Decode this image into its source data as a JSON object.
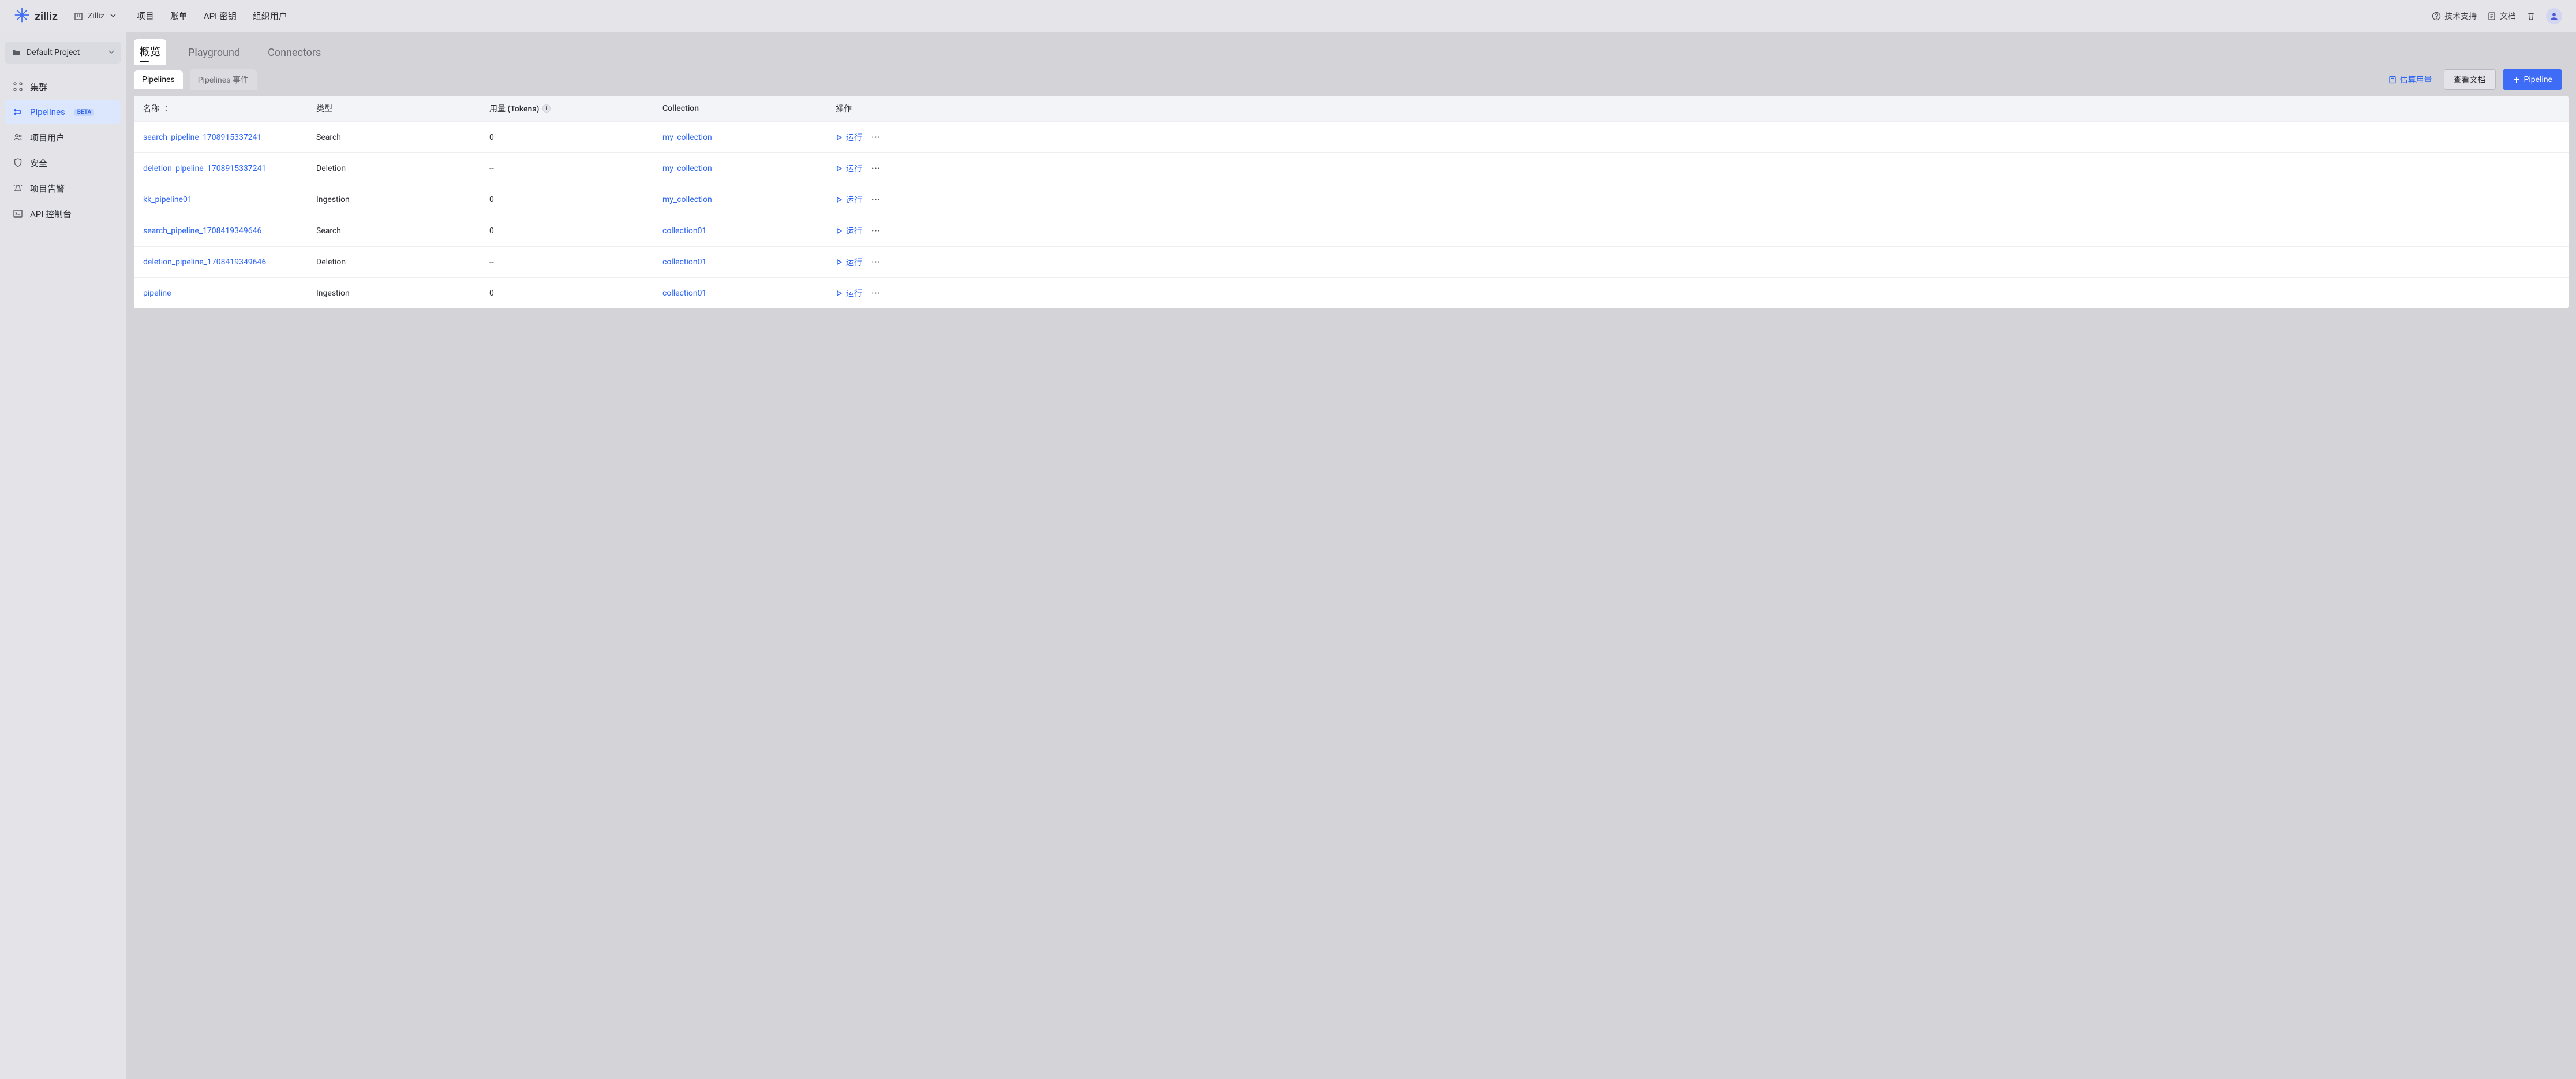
{
  "header": {
    "logo_text": "zilliz",
    "org": {
      "name": "Zilliz"
    },
    "nav": {
      "projects": "项目",
      "billing": "账单",
      "api_keys": "API 密钥",
      "org_users": "组织用户"
    },
    "right": {
      "support": "技术支持",
      "docs": "文档"
    }
  },
  "sidebar": {
    "project": "Default Project",
    "items": {
      "clusters": "集群",
      "pipelines": "Pipelines",
      "pipelines_beta": "BETA",
      "project_users": "项目用户",
      "security": "安全",
      "alerts": "项目告警",
      "api_console": "API 控制台"
    }
  },
  "tabs_top": {
    "overview": "概览",
    "playground": "Playground",
    "connectors": "Connectors"
  },
  "subtabs": {
    "pipelines": "Pipelines",
    "events": "Pipelines 事件"
  },
  "toolbar": {
    "estimate": "估算用量",
    "view_docs": "查看文档",
    "new_pipeline": "Pipeline"
  },
  "table": {
    "cols": {
      "name": "名称",
      "type": "类型",
      "usage": "用量 (Tokens)",
      "collection": "Collection",
      "actions": "操作"
    },
    "run_label": "运行",
    "rows": [
      {
        "name": "search_pipeline_1708915337241",
        "type": "Search",
        "usage": "0",
        "collection": "my_collection"
      },
      {
        "name": "deletion_pipeline_1708915337241",
        "type": "Deletion",
        "usage": "--",
        "collection": "my_collection"
      },
      {
        "name": "kk_pipeline01",
        "type": "Ingestion",
        "usage": "0",
        "collection": "my_collection"
      },
      {
        "name": "search_pipeline_1708419349646",
        "type": "Search",
        "usage": "0",
        "collection": "collection01"
      },
      {
        "name": "deletion_pipeline_1708419349646",
        "type": "Deletion",
        "usage": "--",
        "collection": "collection01"
      },
      {
        "name": "pipeline",
        "type": "Ingestion",
        "usage": "0",
        "collection": "collection01"
      }
    ]
  }
}
